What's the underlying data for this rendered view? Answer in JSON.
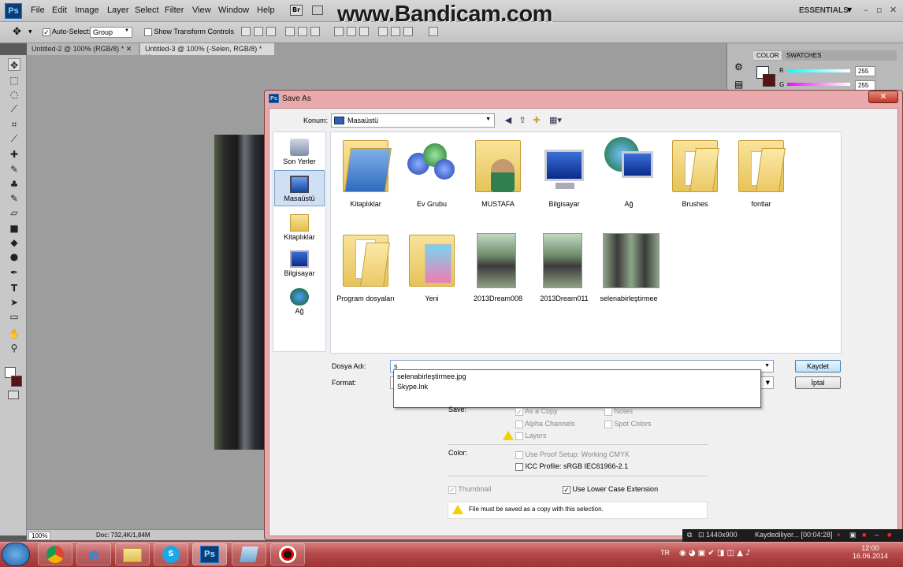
{
  "menubar": {
    "items": [
      "File",
      "Edit",
      "Image",
      "Layer",
      "Select",
      "Filter",
      "View",
      "Window",
      "Help"
    ],
    "badge_br": "Br",
    "watermark": "www.Bandicam.com",
    "workspace": "ESSENTIALS"
  },
  "options_bar": {
    "auto_select_label": "Auto-Select:",
    "auto_select_value": "Group",
    "transform_label": "Show Transform Controls"
  },
  "tabs": [
    {
      "label": "Untitled-2 @ 100% (RGB/8) *"
    },
    {
      "label": "Untitled-3 @ 100% (-Selen, RGB/8) *"
    }
  ],
  "status_bar": {
    "zoom": "100%",
    "doc": "Doc: 732,4K/1,84M"
  },
  "right_panel": {
    "tabs": [
      "COLOR",
      "SWATCHES"
    ],
    "r_label": "R",
    "r_value": "255",
    "g_label": "G",
    "g_value": "255"
  },
  "dialog": {
    "title": "Save As",
    "close": "✕",
    "konum_label": "Konum:",
    "konum_value": "Masaüstü",
    "places": [
      "Son Yerler",
      "Masaüstü",
      "Kitaplıklar",
      "Bilgisayar",
      "Ağ"
    ],
    "files_row1": [
      "Kitaplıklar",
      "Ev Grubu",
      "MUSTAFA",
      "Bilgisayar",
      "Ağ",
      "Brushes",
      "fontlar"
    ],
    "files_row2": [
      "Program dosyaları",
      "Yeni",
      "2013Dream008",
      "2013Dream011",
      "selenabirleştirmee"
    ],
    "filename_label": "Dosya Adı:",
    "filename_value": "s",
    "format_label": "Format:",
    "autocomplete": [
      "selenabirleştirmee.jpg",
      "Skype.lnk"
    ],
    "save_button": "Kaydet",
    "cancel_button": "İptal",
    "save_section": "Save:",
    "save_options": {
      "as_copy": "As a Copy",
      "notes": "Notes",
      "alpha": "Alpha Channels",
      "spot": "Spot Colors",
      "layers": "Layers"
    },
    "color_section": "Color:",
    "proof_setup": "Use Proof Setup:  Working CMYK",
    "icc_profile": "ICC Profile:  sRGB IEC61966-2.1",
    "thumbnail": "Thumbnail",
    "lower_case": "Use Lower Case Extension",
    "note": "File must be saved as a copy with this selection."
  },
  "recorder": {
    "resolution": "1440x900",
    "status": "Kaydediliyor... [00:04:28]"
  },
  "taskbar": {
    "lang": "TR",
    "time": "12:00",
    "date": "16.06.2014",
    "ps_label": "Ps"
  }
}
